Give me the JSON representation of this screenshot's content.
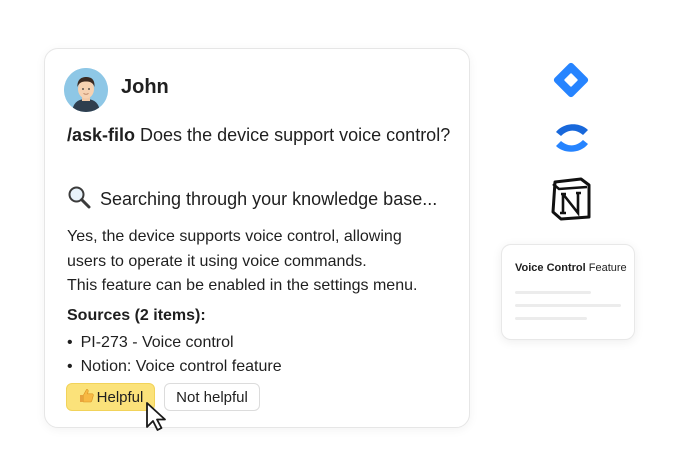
{
  "chat": {
    "user_name": "John",
    "command": "/ask-filo",
    "question": " Does the device support voice control?",
    "status": "Searching through your knowledge base...",
    "answer_lines": [
      "Yes, the device supports voice control, allowing",
      "users to operate it using voice commands.",
      "This feature can be enabled in the settings menu."
    ],
    "sources_title": "Sources (2 items):",
    "sources": [
      "PI-273 - Voice control",
      "Notion: Voice control feature"
    ],
    "helpful_label": "Helpful",
    "not_helpful_label": "Not helpful"
  },
  "integrations": [
    "jira-icon",
    "confluence-icon",
    "notion-icon"
  ],
  "snippet": {
    "title_bold": "Voice Control",
    "title_rest": " Feature"
  },
  "colors": {
    "helpful_bg": "#fbe27a",
    "jira_blue": "#2684ff",
    "confluence_blue": "#1868db"
  }
}
